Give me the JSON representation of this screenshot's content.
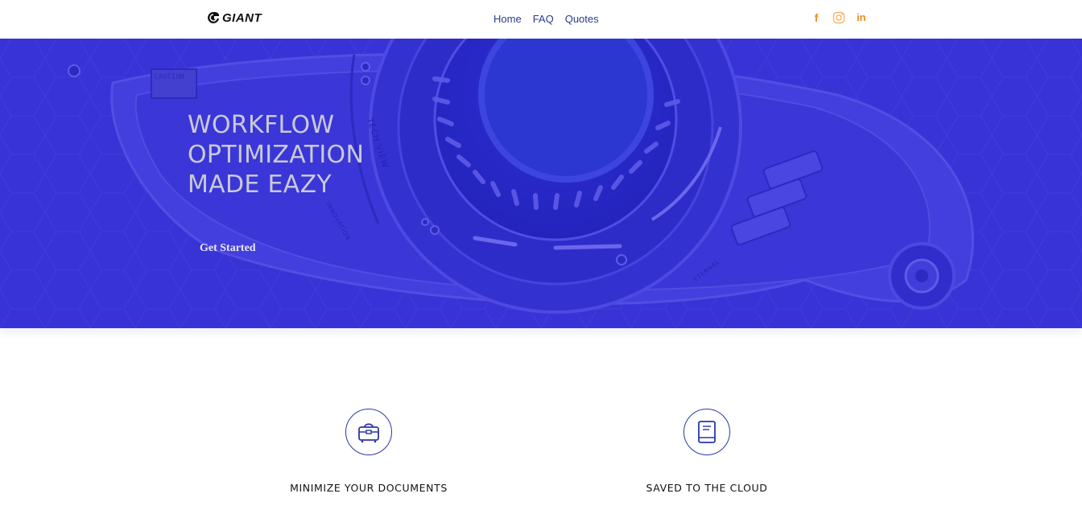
{
  "header": {
    "logo_text": "GIANT",
    "nav": [
      {
        "label": "Home"
      },
      {
        "label": "FAQ"
      },
      {
        "label": "Quotes"
      }
    ],
    "social": [
      {
        "icon": "facebook-icon",
        "glyph": "f",
        "color": "#f38a1e"
      },
      {
        "icon": "instagram-icon",
        "color": "#f6b26b"
      },
      {
        "icon": "linkedin-icon",
        "glyph": "in",
        "color": "#f38a1e"
      }
    ]
  },
  "hero": {
    "title_lines": [
      "WORKFLOW",
      "OPTIMIZATION",
      "MADE EAZY"
    ],
    "cta_label": "Get Started",
    "image_text": {
      "tech_view": "TECH VIEW",
      "innovation": "INNOVATION",
      "caution": "CAUTION",
      "eternal": "ETERNAL"
    },
    "background_color": "#3a35d6"
  },
  "features": [
    {
      "icon": "briefcase-icon",
      "label": "MINIMIZE YOUR DOCUMENTS"
    },
    {
      "icon": "book-icon",
      "label": "SAVED TO THE CLOUD"
    }
  ],
  "colors": {
    "accent_nav": "#2a3a8f",
    "social": "#f38a1e",
    "icon_stroke": "#2b36a8"
  }
}
